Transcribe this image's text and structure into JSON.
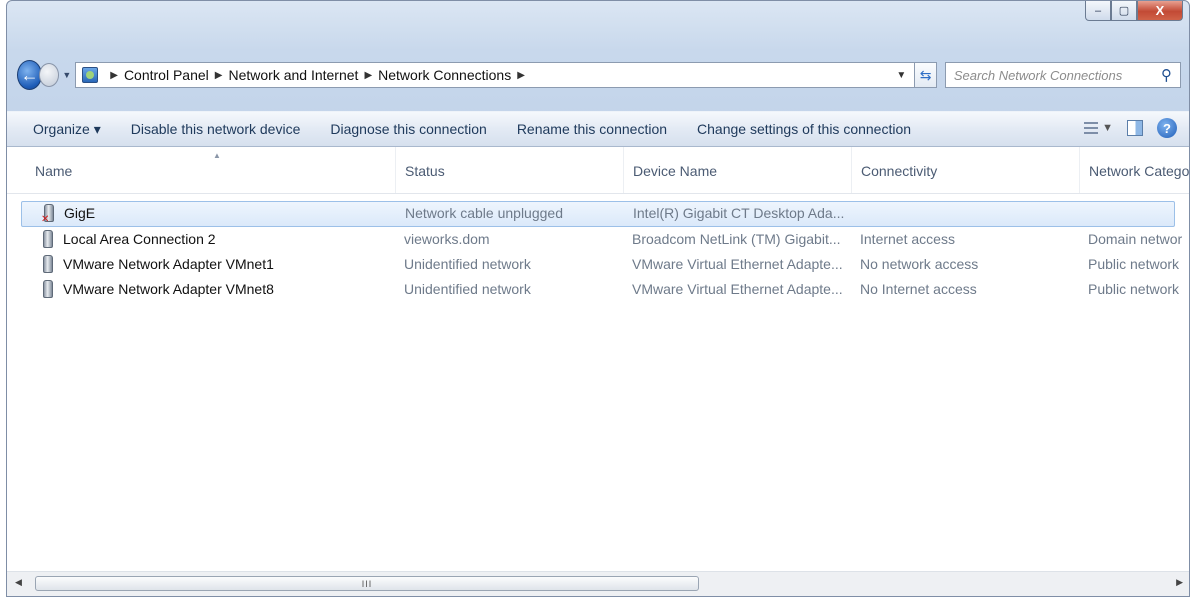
{
  "window": {
    "caption": {
      "minimize": "–",
      "maximize": "▢",
      "close": "X"
    }
  },
  "address": {
    "breadcrumb": [
      "Control Panel",
      "Network and Internet",
      "Network Connections"
    ],
    "search_placeholder": "Search Network Connections"
  },
  "toolbar": {
    "items": [
      "Organize ▾",
      "Disable this network device",
      "Diagnose this connection",
      "Rename this connection",
      "Change settings of this connection"
    ]
  },
  "columns": [
    "Name",
    "Status",
    "Device Name",
    "Connectivity",
    "Network Catego"
  ],
  "rows": [
    {
      "name": "GigE",
      "status": "Network cable unplugged",
      "device": "Intel(R) Gigabit CT Desktop Ada...",
      "connectivity": "",
      "category": "",
      "selected": true,
      "disconnected": true
    },
    {
      "name": "Local Area Connection 2",
      "status": "vieworks.dom",
      "device": "Broadcom NetLink (TM) Gigabit...",
      "connectivity": "Internet access",
      "category": "Domain networ"
    },
    {
      "name": "VMware Network Adapter VMnet1",
      "status": "Unidentified network",
      "device": "VMware Virtual Ethernet Adapte...",
      "connectivity": "No network access",
      "category": "Public network"
    },
    {
      "name": "VMware Network Adapter VMnet8",
      "status": "Unidentified network",
      "device": "VMware Virtual Ethernet Adapte...",
      "connectivity": "No Internet access",
      "category": "Public network"
    }
  ],
  "scrollbar": {
    "thumb_grip": "III"
  }
}
